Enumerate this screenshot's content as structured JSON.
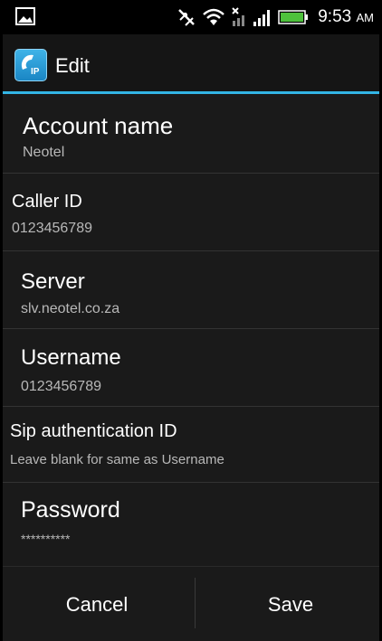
{
  "status_bar": {
    "time": "9:53",
    "ampm": "AM",
    "icons": [
      "image-icon",
      "sync-off-icon",
      "wifi-icon",
      "mobile-data-icon",
      "signal-icon",
      "battery-icon"
    ]
  },
  "action_bar": {
    "title": "Edit",
    "app_icon_label": "IP"
  },
  "fields": [
    {
      "label": "Account name",
      "value": "Neotel"
    },
    {
      "label": "Caller ID",
      "value": "0123456789"
    },
    {
      "label": "Server",
      "value": "slv.neotel.co.za"
    },
    {
      "label": "Username",
      "value": "0123456789"
    },
    {
      "label": "Sip authentication ID",
      "value": "Leave blank for same as Username"
    },
    {
      "label": "Password",
      "value": "**********"
    }
  ],
  "buttons": {
    "cancel": "Cancel",
    "save": "Save"
  },
  "colors": {
    "accent": "#33b5e5",
    "background": "#1a1a1a",
    "secondary_text": "#b8b8b8"
  }
}
